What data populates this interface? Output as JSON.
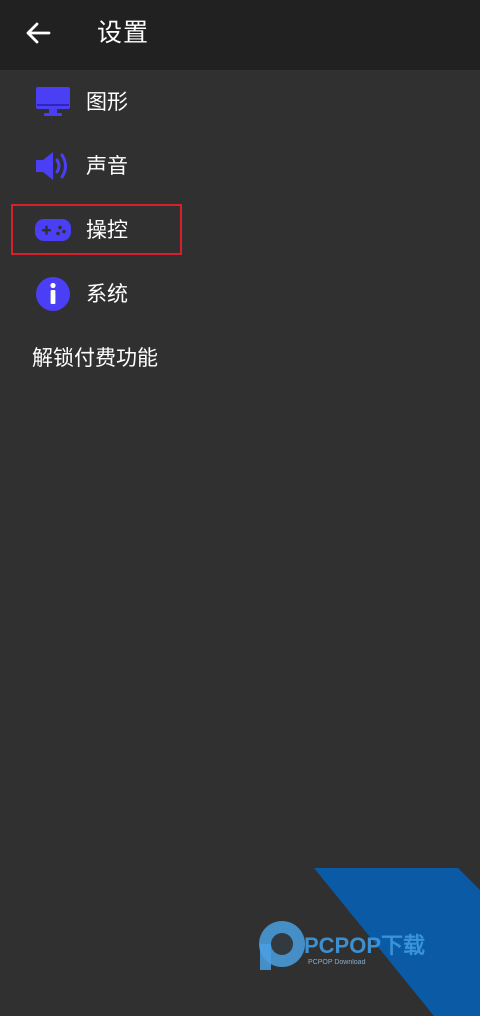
{
  "header": {
    "title": "设置",
    "back_icon": "arrow-left-icon"
  },
  "menu": {
    "items": [
      {
        "label": "图形",
        "icon": "monitor-icon"
      },
      {
        "label": "声音",
        "icon": "speaker-icon"
      },
      {
        "label": "操控",
        "icon": "gamepad-icon",
        "highlighted": true
      },
      {
        "label": "系统",
        "icon": "info-icon"
      },
      {
        "label": "解锁付费功能"
      }
    ]
  },
  "watermark": {
    "brand": "PCPOP下载",
    "sub": "PCPOP Download"
  },
  "colors": {
    "background": "#303030",
    "app_bar": "#212121",
    "icon_accent": "#4a3ff5",
    "highlight_border": "#d6202b",
    "watermark_blue": "#0b5aa6"
  }
}
